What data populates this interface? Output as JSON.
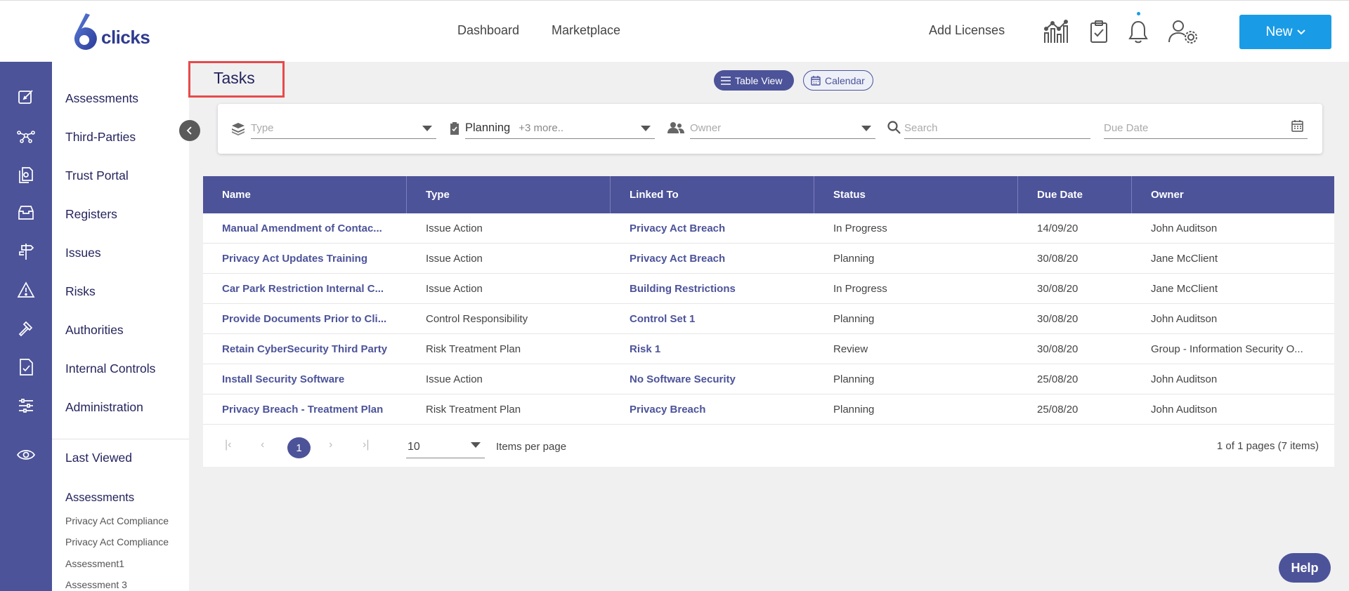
{
  "brand": {
    "logo_text": "clicks",
    "logo_mark": "6"
  },
  "topnav": {
    "dashboard": "Dashboard",
    "marketplace": "Marketplace",
    "add_licenses": "Add Licenses",
    "new_button": "New"
  },
  "rail_icons": [
    "edit-icon",
    "network-icon",
    "documents-icon",
    "archive-icon",
    "signpost-icon",
    "warning-icon",
    "gavel-icon",
    "checklist-icon",
    "sliders-icon",
    "eye-icon"
  ],
  "sidebar": {
    "items": [
      "Assessments",
      "Third-Parties",
      "Trust Portal",
      "Registers",
      "Issues",
      "Risks",
      "Authorities",
      "Internal Controls",
      "Administration"
    ],
    "last_viewed": "Last Viewed",
    "recent_section": "Assessments",
    "recent_items": [
      "Privacy Act Compliance",
      "Privacy Act Compliance",
      "Assessment1",
      "Assessment 3"
    ]
  },
  "page": {
    "title": "Tasks",
    "table_view": "Table View",
    "calendar": "Calendar"
  },
  "filters": {
    "type_placeholder": "Type",
    "status_value": "Planning",
    "status_more": "+3 more..",
    "owner_placeholder": "Owner",
    "search_placeholder": "Search",
    "due_placeholder": "Due Date"
  },
  "table": {
    "columns": [
      "Name",
      "Type",
      "Linked To",
      "Status",
      "Due Date",
      "Owner"
    ],
    "rows": [
      [
        "Manual Amendment of Contac...",
        "Issue Action",
        "Privacy Act Breach",
        "In Progress",
        "14/09/20",
        "John Auditson"
      ],
      [
        "Privacy Act Updates Training",
        "Issue Action",
        "Privacy Act Breach",
        "Planning",
        "30/08/20",
        "Jane McClient"
      ],
      [
        "Car Park Restriction Internal C...",
        "Issue Action",
        "Building Restrictions",
        "In Progress",
        "30/08/20",
        "Jane McClient"
      ],
      [
        "Provide Documents Prior to Cli...",
        "Control Responsibility",
        "Control Set 1",
        "Planning",
        "30/08/20",
        "John Auditson"
      ],
      [
        "Retain CyberSecurity Third Party",
        "Risk Treatment Plan",
        "Risk 1",
        "Review",
        "30/08/20",
        "Group - Information Security O..."
      ],
      [
        "Install Security Software",
        "Issue Action",
        "No Software Security",
        "Planning",
        "25/08/20",
        "John Auditson"
      ],
      [
        "Privacy Breach - Treatment Plan",
        "Risk Treatment Plan",
        "Privacy Breach",
        "Planning",
        "25/08/20",
        "John Auditson"
      ]
    ]
  },
  "pager": {
    "current": "1",
    "page_size": "10",
    "items_per_page": "Items per page",
    "info": "1 of 1 pages (7 items)"
  },
  "help": "Help",
  "colors": {
    "primary": "#4c5399",
    "accent": "#1a9be6",
    "highlight_box": "#e84a4a"
  }
}
